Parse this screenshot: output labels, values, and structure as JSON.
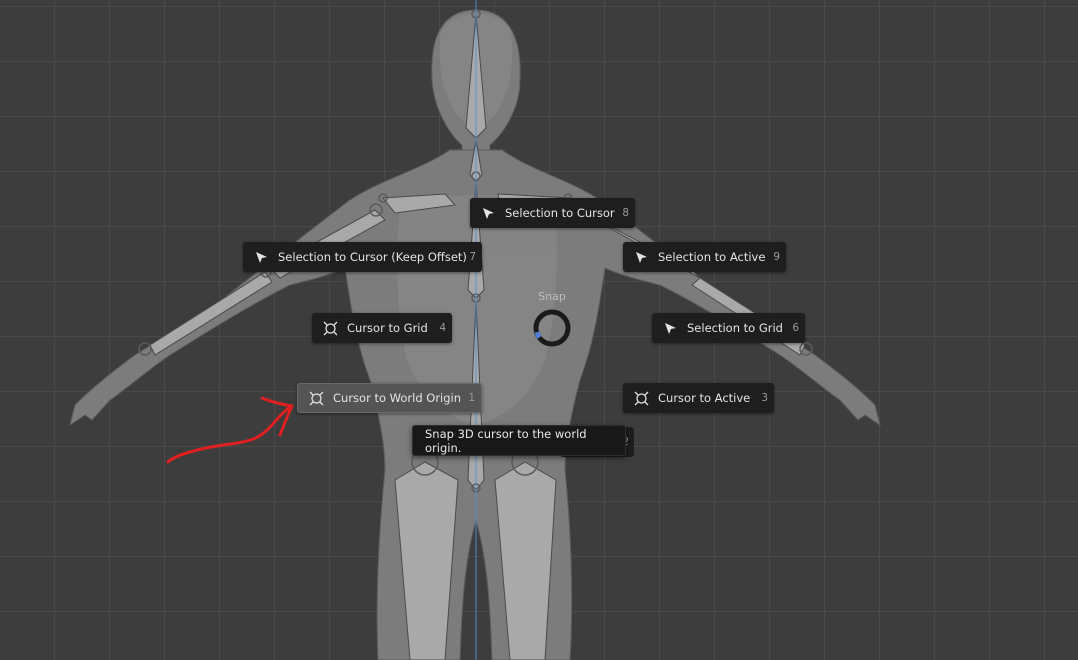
{
  "pie_menu": {
    "title": "Snap",
    "items": [
      {
        "id": "selection-to-cursor",
        "icon": "cursor-arrow-icon",
        "label": "Selection to Cursor",
        "key": "8"
      },
      {
        "id": "selection-to-cursor-keep-offset",
        "icon": "cursor-arrow-icon",
        "label": "Selection to Cursor (Keep Offset)",
        "key": "7"
      },
      {
        "id": "selection-to-active",
        "icon": "cursor-arrow-icon",
        "label": "Selection to Active",
        "key": "9"
      },
      {
        "id": "cursor-to-grid",
        "icon": "3d-cursor-icon",
        "label": "Cursor to Grid",
        "key": "4"
      },
      {
        "id": "selection-to-grid",
        "icon": "cursor-arrow-icon",
        "label": "Selection to Grid",
        "key": "6"
      },
      {
        "id": "cursor-to-world-origin",
        "icon": "3d-cursor-icon",
        "label": "Cursor to World Origin",
        "key": "1"
      },
      {
        "id": "cursor-to-active",
        "icon": "3d-cursor-icon",
        "label": "Cursor to Active",
        "key": "3"
      }
    ],
    "hidden_item_key": "2",
    "hovered_item": "Cursor to World Origin"
  },
  "tooltip": {
    "text": "Snap 3D cursor to the world origin."
  },
  "colors": {
    "viewport_bg": "#3d3d3d",
    "grid_line": "#4a4a4a",
    "menu_bg": "#1e1e1e",
    "menu_hover_bg": "#545454",
    "ring_accent": "#4f7fd1",
    "annotation_red": "#e02020",
    "axis_blue": "#5a8fd6"
  }
}
